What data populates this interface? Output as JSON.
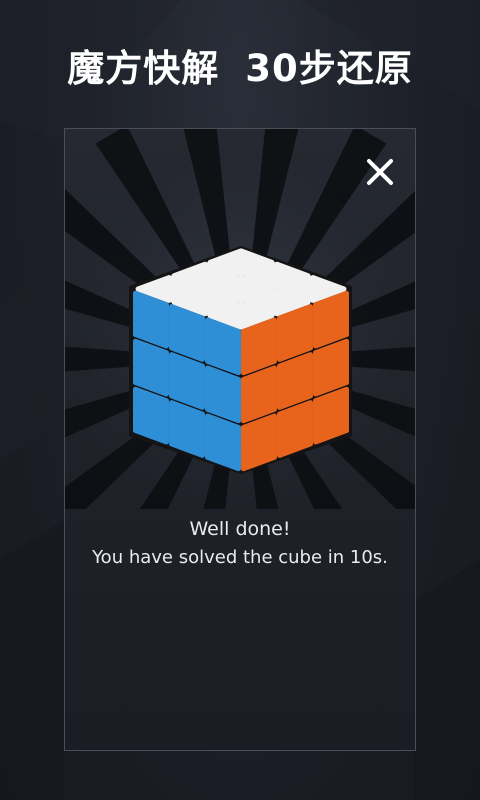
{
  "headline": {
    "part1": "魔方快解",
    "part2": "30步还原"
  },
  "dialog": {
    "close_icon": "close-icon",
    "cube_icon": "rubiks-cube-icon",
    "message_title": "Well done!",
    "message_body": "You have solved the cube in 10s."
  },
  "colors": {
    "background": "#1a1d25",
    "cube_top": "#f1f1f1",
    "cube_left": "#2f8fd6",
    "cube_right": "#e8641c",
    "cube_body": "#141414",
    "text": "#ffffff"
  }
}
